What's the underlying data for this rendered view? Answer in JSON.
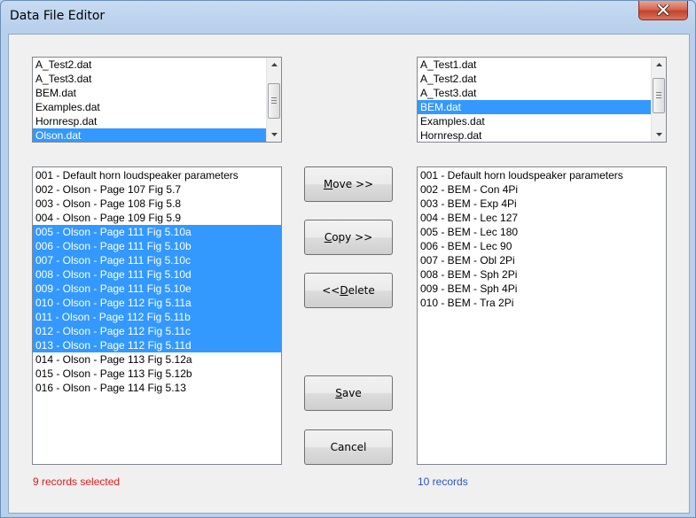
{
  "window": {
    "title": "Data File Editor"
  },
  "colors": {
    "selection": "#3399ff",
    "status_selected": "#e01b1b",
    "status_records": "#2b55c4"
  },
  "left_files": {
    "items": [
      "A_Test2.dat",
      "A_Test3.dat",
      "BEM.dat",
      "Examples.dat",
      "Hornresp.dat",
      "Olson.dat"
    ],
    "selected_index": 5
  },
  "right_files": {
    "items": [
      "A_Test1.dat",
      "A_Test2.dat",
      "A_Test3.dat",
      "BEM.dat",
      "Examples.dat",
      "Hornresp.dat"
    ],
    "selected_index": 3
  },
  "left_records": {
    "items": [
      "001 - Default horn loudspeaker parameters",
      "002 - Olson - Page 107 Fig 5.7",
      "003 - Olson - Page 108 Fig 5.8",
      "004 - Olson - Page 109 Fig 5.9",
      "005 - Olson - Page 111 Fig 5.10a",
      "006 - Olson - Page 111 Fig 5.10b",
      "007 - Olson - Page 111 Fig 5.10c",
      "008 - Olson - Page 111 Fig 5.10d",
      "009 - Olson - Page 111 Fig 5.10e",
      "010 - Olson - Page 112 Fig 5.11a",
      "011 - Olson - Page 112 Fig 5.11b",
      "012 - Olson - Page 112 Fig 5.11c",
      "013 - Olson - Page 112 Fig 5.11d",
      "014 - Olson - Page 113 Fig 5.12a",
      "015 - Olson - Page 113 Fig 5.12b",
      "016 - Olson - Page 114 Fig 5.13"
    ],
    "selected_indices": [
      4,
      5,
      6,
      7,
      8,
      9,
      10,
      11,
      12
    ]
  },
  "right_records": {
    "items": [
      "001 - Default horn loudspeaker parameters",
      "002 - BEM - Con 4Pi",
      "003 - BEM - Exp 4Pi",
      "004 - BEM - Lec 127",
      "005 - BEM - Lec 180",
      "006 - BEM - Lec 90",
      "007 - BEM - Obl 2Pi",
      "008 - BEM - Sph 2Pi",
      "009 - BEM - Sph 4Pi",
      "010 - BEM - Tra 2Pi"
    ],
    "selected_indices": []
  },
  "buttons": {
    "move": {
      "pre": "",
      "key": "M",
      "post": "ove >>"
    },
    "copy": {
      "pre": "",
      "key": "C",
      "post": "opy >>"
    },
    "delete": {
      "pre": "<< ",
      "key": "D",
      "post": "elete"
    },
    "save": {
      "pre": "",
      "key": "S",
      "post": "ave"
    },
    "cancel": {
      "label": "Cancel"
    }
  },
  "status": {
    "left": "9 records selected",
    "right": "10 records"
  }
}
